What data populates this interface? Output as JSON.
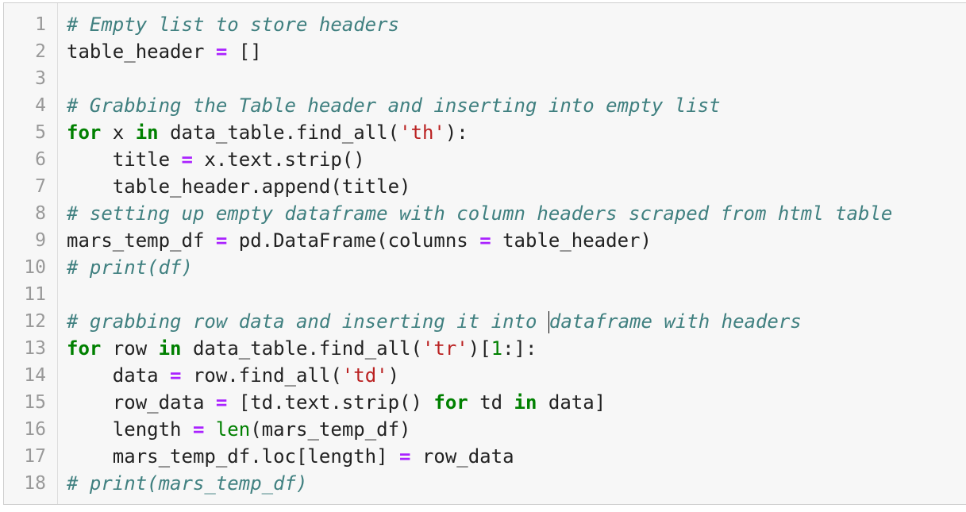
{
  "colors": {
    "comment": "#408080",
    "keyword": "#008000",
    "operator": "#aa22ff",
    "string": "#ba2121",
    "number": "#008000",
    "text": "#222222",
    "gutter_text": "#999999",
    "background": "#f7f7f7"
  },
  "lines": [
    {
      "num": "1",
      "tokens": [
        {
          "t": "comment",
          "v": "# Empty list to store headers"
        }
      ]
    },
    {
      "num": "2",
      "tokens": [
        {
          "t": "plain",
          "v": "table_header "
        },
        {
          "t": "op",
          "v": "="
        },
        {
          "t": "plain",
          "v": " []"
        }
      ]
    },
    {
      "num": "3",
      "tokens": []
    },
    {
      "num": "4",
      "tokens": [
        {
          "t": "comment",
          "v": "# Grabbing the Table header and inserting into empty list"
        }
      ]
    },
    {
      "num": "5",
      "tokens": [
        {
          "t": "keyword",
          "v": "for"
        },
        {
          "t": "plain",
          "v": " x "
        },
        {
          "t": "keyword",
          "v": "in"
        },
        {
          "t": "plain",
          "v": " data_table.find_all("
        },
        {
          "t": "string",
          "v": "'th'"
        },
        {
          "t": "plain",
          "v": "):"
        }
      ]
    },
    {
      "num": "6",
      "tokens": [
        {
          "t": "plain",
          "v": "    title "
        },
        {
          "t": "op",
          "v": "="
        },
        {
          "t": "plain",
          "v": " x.text.strip()"
        }
      ]
    },
    {
      "num": "7",
      "tokens": [
        {
          "t": "plain",
          "v": "    table_header.append(title)"
        }
      ]
    },
    {
      "num": "8",
      "tokens": [
        {
          "t": "comment",
          "v": "# setting up empty dataframe with column headers scraped from html table"
        }
      ]
    },
    {
      "num": "9",
      "tokens": [
        {
          "t": "plain",
          "v": "mars_temp_df "
        },
        {
          "t": "op",
          "v": "="
        },
        {
          "t": "plain",
          "v": " pd.DataFrame(columns "
        },
        {
          "t": "op",
          "v": "="
        },
        {
          "t": "plain",
          "v": " table_header)"
        }
      ]
    },
    {
      "num": "10",
      "tokens": [
        {
          "t": "comment",
          "v": "# print(df)"
        }
      ]
    },
    {
      "num": "11",
      "tokens": []
    },
    {
      "num": "12",
      "tokens": [
        {
          "t": "comment",
          "v": "# grabbing row data and inserting it into "
        },
        {
          "t": "cursor",
          "v": ""
        },
        {
          "t": "comment",
          "v": "dataframe with headers"
        }
      ]
    },
    {
      "num": "13",
      "tokens": [
        {
          "t": "keyword",
          "v": "for"
        },
        {
          "t": "plain",
          "v": " row "
        },
        {
          "t": "keyword",
          "v": "in"
        },
        {
          "t": "plain",
          "v": " data_table.find_all("
        },
        {
          "t": "string",
          "v": "'tr'"
        },
        {
          "t": "plain",
          "v": ")["
        },
        {
          "t": "number",
          "v": "1"
        },
        {
          "t": "plain",
          "v": ":]:"
        }
      ]
    },
    {
      "num": "14",
      "tokens": [
        {
          "t": "plain",
          "v": "    data "
        },
        {
          "t": "op",
          "v": "="
        },
        {
          "t": "plain",
          "v": " row.find_all("
        },
        {
          "t": "string",
          "v": "'td'"
        },
        {
          "t": "plain",
          "v": ")"
        }
      ]
    },
    {
      "num": "15",
      "tokens": [
        {
          "t": "plain",
          "v": "    row_data "
        },
        {
          "t": "op",
          "v": "="
        },
        {
          "t": "plain",
          "v": " [td.text.strip() "
        },
        {
          "t": "keyword",
          "v": "for"
        },
        {
          "t": "plain",
          "v": " td "
        },
        {
          "t": "keyword",
          "v": "in"
        },
        {
          "t": "plain",
          "v": " data]"
        }
      ]
    },
    {
      "num": "16",
      "tokens": [
        {
          "t": "plain",
          "v": "    length "
        },
        {
          "t": "op",
          "v": "="
        },
        {
          "t": "plain",
          "v": " "
        },
        {
          "t": "builtin",
          "v": "len"
        },
        {
          "t": "plain",
          "v": "(mars_temp_df)"
        }
      ]
    },
    {
      "num": "17",
      "tokens": [
        {
          "t": "plain",
          "v": "    mars_temp_df.loc[length] "
        },
        {
          "t": "op",
          "v": "="
        },
        {
          "t": "plain",
          "v": " row_data"
        }
      ]
    },
    {
      "num": "18",
      "tokens": [
        {
          "t": "comment",
          "v": "# print(mars_temp_df)"
        }
      ]
    }
  ]
}
